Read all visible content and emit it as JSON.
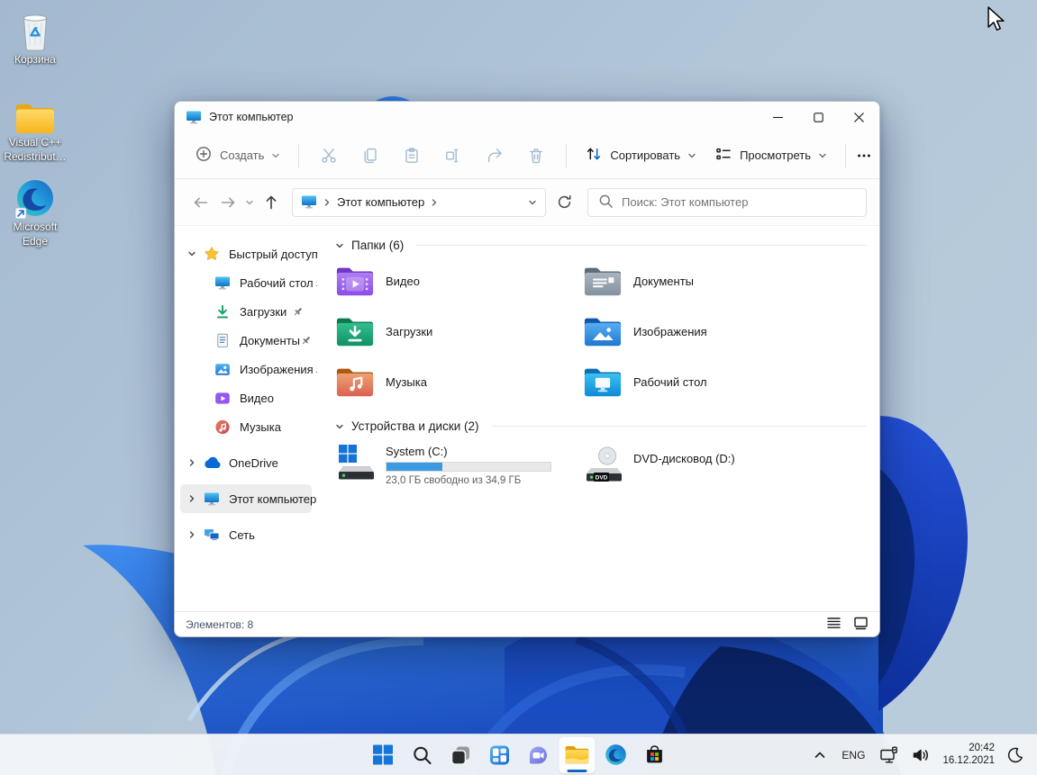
{
  "colors": {
    "accent": "#0b66c3",
    "progress_fill": "#3d9ae1",
    "selection_bg": "#ededed",
    "taskbar_bg": "#f2f5f8"
  },
  "desktop": {
    "icons": [
      {
        "name": "recycle-bin",
        "icon": "recycle-bin",
        "lines": [
          "Корзина"
        ]
      },
      {
        "name": "visual-cpp-redistributable",
        "icon": "folder-yellow",
        "lines": [
          "Visual C++",
          "Redistribut…"
        ]
      },
      {
        "name": "microsoft-edge",
        "icon": "edge-shortcut",
        "lines": [
          "Microsoft",
          "Edge"
        ]
      }
    ]
  },
  "window": {
    "title": "Этот компьютер",
    "toolbar": {
      "create_label": "Создать",
      "sort_label": "Сортировать",
      "view_label": "Просмотреть"
    },
    "navigation": {
      "address_path": "Этот компьютер",
      "search_placeholder": "Поиск: Этот компьютер"
    },
    "sidebar": {
      "items": [
        {
          "name": "quick-access",
          "label": "Быстрый доступ",
          "icon": "star",
          "chevron": "down",
          "level": 0
        },
        {
          "name": "desktop",
          "label": "Рабочий стол",
          "icon": "monitor",
          "level": 1,
          "pinned": true
        },
        {
          "name": "downloads",
          "label": "Загрузки",
          "icon": "downloads",
          "level": 1,
          "pinned": true
        },
        {
          "name": "documents",
          "label": "Документы",
          "icon": "documents",
          "level": 1,
          "pinned": true
        },
        {
          "name": "pictures",
          "label": "Изображения",
          "icon": "pictures",
          "level": 1,
          "pinned": true
        },
        {
          "name": "videos",
          "label": "Видео",
          "icon": "videos",
          "level": 1
        },
        {
          "name": "music",
          "label": "Музыка",
          "icon": "music",
          "level": 1
        },
        {
          "name": "onedrive",
          "label": "OneDrive",
          "icon": "onedrive",
          "chevron": "right",
          "level": 0,
          "gap": true
        },
        {
          "name": "this-pc",
          "label": "Этот компьютер",
          "icon": "monitor",
          "chevron": "right",
          "level": 0,
          "selected": true,
          "gap": true
        },
        {
          "name": "network",
          "label": "Сеть",
          "icon": "network",
          "chevron": "right",
          "level": 0,
          "gap": true
        }
      ]
    },
    "content": {
      "sections": [
        {
          "header": "Папки (6)"
        },
        {
          "header": "Устройства и диски (2)"
        }
      ],
      "folders": [
        {
          "name": "videos",
          "label": "Видео",
          "icon": "folder-videos"
        },
        {
          "name": "downloads",
          "label": "Загрузки",
          "icon": "folder-downloads"
        },
        {
          "name": "music",
          "label": "Музыка",
          "icon": "folder-music"
        },
        {
          "name": "documents",
          "label": "Документы",
          "icon": "folder-documents"
        },
        {
          "name": "pictures",
          "label": "Изображения",
          "icon": "folder-pictures"
        },
        {
          "name": "desktop",
          "label": "Рабочий стол",
          "icon": "folder-desktop"
        }
      ],
      "drives": [
        {
          "name": "system-c",
          "label": "System (C:)",
          "icon": "drive-system",
          "caption": "23,0 ГБ свободно из 34,9 ГБ",
          "fill_percent": 34
        },
        {
          "name": "dvd-d",
          "label": "DVD-дисковод (D:)",
          "icon": "drive-dvd",
          "badge": "DVD"
        }
      ]
    },
    "status_bar": {
      "items_text": "Элементов: 8"
    }
  },
  "taskbar": {
    "buttons": [
      {
        "name": "start",
        "icon": "start"
      },
      {
        "name": "search",
        "icon": "search"
      },
      {
        "name": "task-view",
        "icon": "taskview"
      },
      {
        "name": "widgets",
        "icon": "widgets"
      },
      {
        "name": "chat",
        "icon": "chat"
      },
      {
        "name": "explorer",
        "icon": "explorer",
        "active": true
      },
      {
        "name": "edge",
        "icon": "edge"
      },
      {
        "name": "store",
        "icon": "store"
      }
    ],
    "tray": {
      "language": "ENG",
      "time": "20:42",
      "date": "16.12.2021"
    }
  }
}
